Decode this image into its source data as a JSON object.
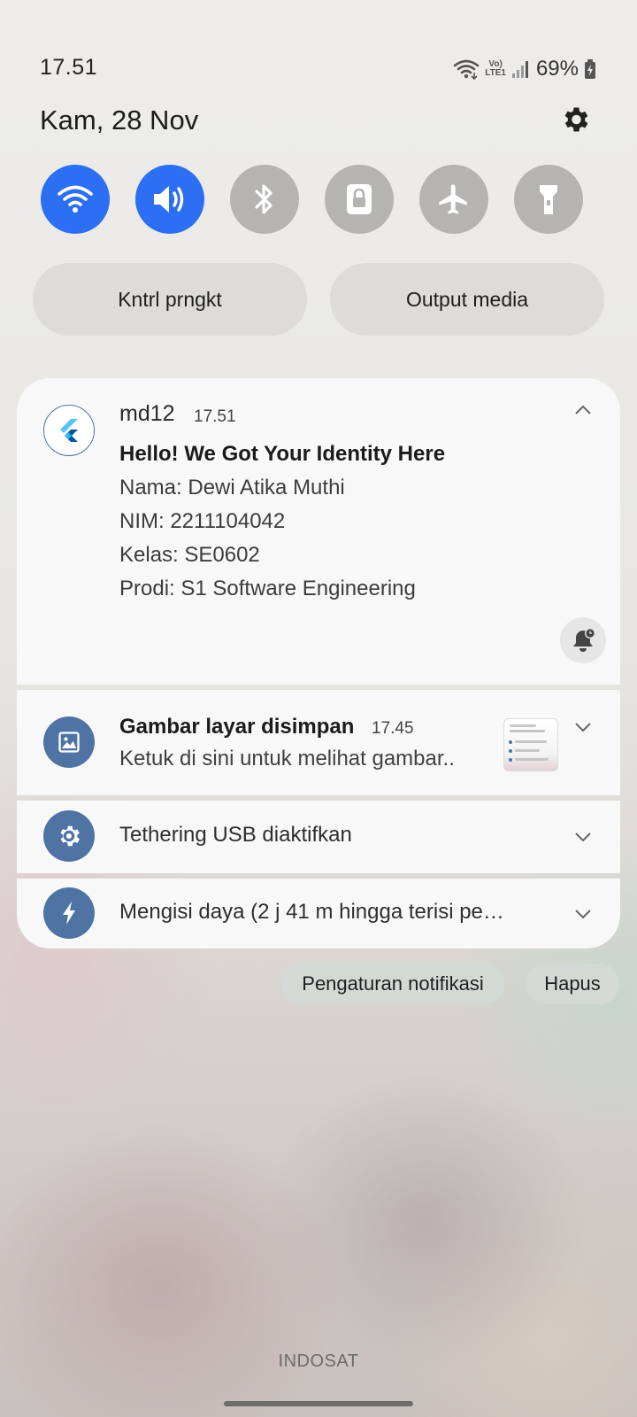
{
  "status_bar": {
    "time": "17.51",
    "battery_percent": "69%",
    "signal_label": "Vo) LTE1",
    "icons": [
      "wifi-icon",
      "volte-icon",
      "signal-icon",
      "battery-charging-icon"
    ]
  },
  "header": {
    "date": "Kam, 28 Nov",
    "settings_icon": "gear-icon"
  },
  "quick_settings": {
    "tiles": [
      {
        "name": "wifi",
        "icon": "wifi-icon",
        "on": true
      },
      {
        "name": "sound",
        "icon": "speaker-icon",
        "on": true
      },
      {
        "name": "bluetooth",
        "icon": "bluetooth-icon",
        "on": false
      },
      {
        "name": "rotation-lock",
        "icon": "lock-icon",
        "on": false
      },
      {
        "name": "airplane-mode",
        "icon": "airplane-icon",
        "on": false
      },
      {
        "name": "flashlight",
        "icon": "flashlight-icon",
        "on": false
      }
    ],
    "device_control_label": "Kntrl prngkt",
    "media_output_label": "Output media"
  },
  "notifications": [
    {
      "app": "md12",
      "time": "17.51",
      "title": "Hello! We Got Your Identity Here",
      "lines": [
        "Nama: Dewi Atika Muthi",
        "NIM: 2211104042",
        "Kelas: SE0602",
        "Prodi: S1 Software Engineering"
      ],
      "icon": "flutter-logo-icon"
    },
    {
      "title": "Gambar layar disimpan",
      "time": "17.45",
      "text": "Ketuk di sini untuk melihat gambar..",
      "icon": "image-icon"
    },
    {
      "title": "Tethering USB diaktifkan",
      "icon": "usb-settings-icon"
    },
    {
      "title": "Mengisi daya (2 j 41 m hingga terisi pe…",
      "icon": "lightning-icon"
    }
  ],
  "actions": {
    "notification_settings": "Pengaturan notifikasi",
    "clear": "Hapus"
  },
  "carrier": "INDOSAT",
  "colors": {
    "accent_on": "#2d6ff2",
    "tile_off": "#b6b4b2",
    "notif_icon_bg": "#4f73a3"
  }
}
